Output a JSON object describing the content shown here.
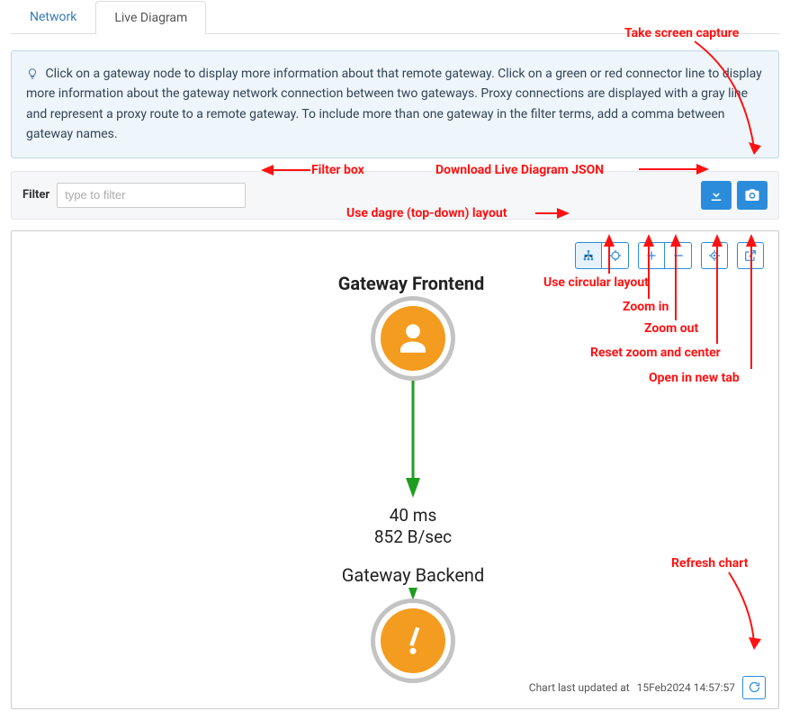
{
  "tabs": {
    "network": "Network",
    "live_diagram": "Live Diagram"
  },
  "info_text": "Click on a gateway node to display more information about that remote gateway. Click on a green or red connector line to display more information about the gateway network connection between two gateways. Proxy connections are displayed with a gray line and represent a proxy route to a remote gateway. To include more than one gateway in the filter terms, add a comma between gateway names.",
  "filter": {
    "label": "Filter",
    "placeholder": "type to filter"
  },
  "toolbar": {
    "download_json": "Download Live Diagram JSON",
    "screenshot": "Take screen capture",
    "layout_dagre": "Use dagre (top-down) layout",
    "layout_circular": "Use circular layout",
    "zoom_in": "Zoom in",
    "zoom_out": "Zoom out",
    "reset_zoom": "Reset zoom and center",
    "open_new_tab": "Open in new tab",
    "refresh": "Refresh chart"
  },
  "diagram": {
    "node_top": "Gateway Frontend",
    "node_bottom": "Gateway Backend",
    "latency": "40 ms",
    "throughput": "852 B/sec"
  },
  "status": {
    "updated_prefix": "Chart last updated at",
    "updated_time": "15Feb2024 14:57:57"
  },
  "annotations": {
    "filter_box": "Filter box",
    "download_json": "Download Live Diagram JSON",
    "screenshot": "Take screen capture",
    "dagre": "Use dagre (top-down) layout",
    "circular": "Use circular layout",
    "zoom_in": "Zoom in",
    "zoom_out": "Zoom out",
    "reset": "Reset zoom and center",
    "new_tab": "Open in new tab",
    "refresh": "Refresh chart"
  }
}
